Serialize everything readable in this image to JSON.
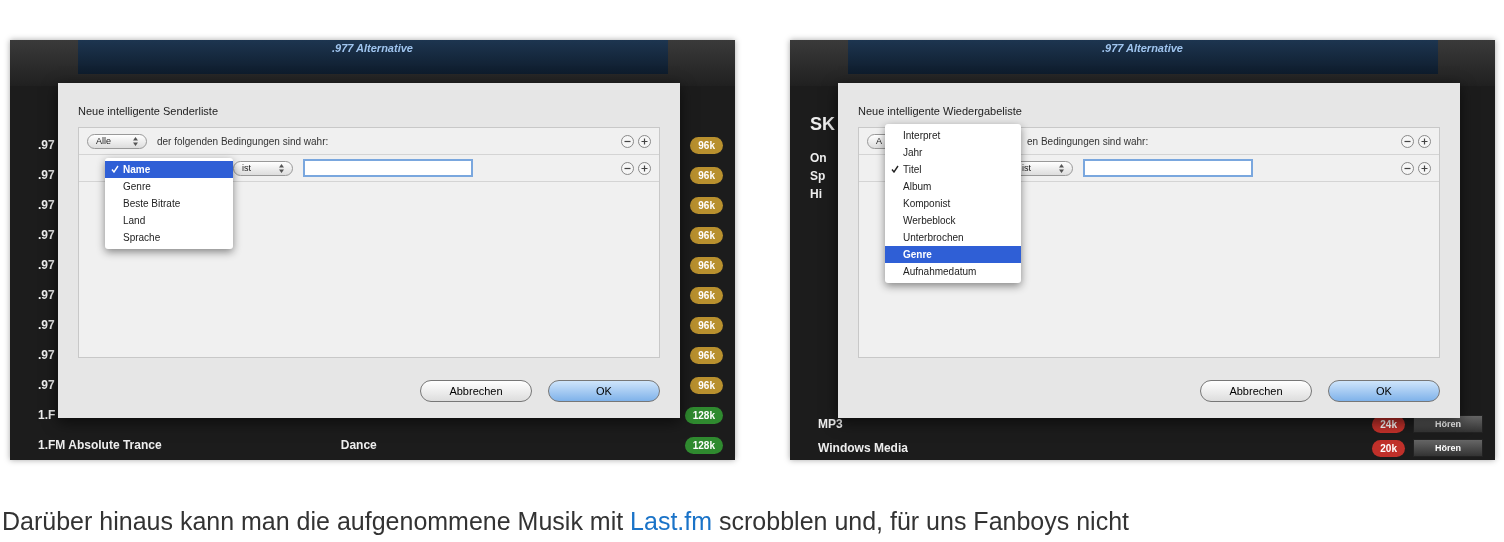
{
  "screenshots": [
    {
      "app_title": ".977 Alternative",
      "rows": [
        {
          "name": ".97",
          "badge": "96k",
          "color": "#b8902e"
        },
        {
          "name": ".97",
          "badge": "96k",
          "color": "#b8902e"
        },
        {
          "name": ".97",
          "badge": "96k",
          "color": "#b8902e"
        },
        {
          "name": ".97",
          "badge": "96k",
          "color": "#b8902e"
        },
        {
          "name": ".97",
          "badge": "96k",
          "color": "#b8902e"
        },
        {
          "name": ".97",
          "badge": "96k",
          "color": "#b8902e"
        },
        {
          "name": ".97",
          "badge": "96k",
          "color": "#b8902e"
        },
        {
          "name": ".97",
          "badge": "96k",
          "color": "#b8902e"
        },
        {
          "name": ".97",
          "badge": "96k",
          "color": "#b8902e"
        },
        {
          "name": "1.F",
          "badge": "128k",
          "color": "#2f8a2f"
        },
        {
          "name": "1.FM Absolute Trance",
          "genre": "Dance",
          "badge": "128k",
          "color": "#2f8a2f"
        }
      ],
      "dialog": {
        "title": "Neue intelligente Senderliste",
        "match_select": "Alle",
        "match_text": "der folgenden Bedingungen sind wahr:",
        "operator_select": "ist",
        "menu": [
          {
            "label": "Name",
            "checked": true,
            "selected": true
          },
          {
            "label": "Genre",
            "checked": false,
            "selected": false
          },
          {
            "label": "Beste Bitrate",
            "checked": false,
            "selected": false
          },
          {
            "label": "Land",
            "checked": false,
            "selected": false
          },
          {
            "label": "Sprache",
            "checked": false,
            "selected": false
          }
        ],
        "buttons": [
          "Abbrechen",
          "OK"
        ]
      }
    },
    {
      "app_title": ".977 Alternative",
      "side_texts": [
        "SK",
        "On",
        "Sp",
        "Hi"
      ],
      "rows": [
        {
          "name": "MP3",
          "badge": "24k",
          "color": "#c0302a",
          "action": "Hören"
        },
        {
          "name": "Windows Media",
          "badge": "20k",
          "color": "#c0302a",
          "action": "Hören"
        }
      ],
      "dialog": {
        "title": "Neue intelligente Wiedergabeliste",
        "match_select": "A",
        "match_text": "en Bedingungen sind wahr:",
        "operator_select": "ist",
        "menu": [
          {
            "label": "Interpret",
            "checked": false,
            "selected": false
          },
          {
            "label": "Jahr",
            "checked": false,
            "selected": false
          },
          {
            "label": "Titel",
            "checked": true,
            "selected": false
          },
          {
            "label": "Album",
            "checked": false,
            "selected": false
          },
          {
            "label": "Komponist",
            "checked": false,
            "selected": false
          },
          {
            "label": "Werbeblock",
            "checked": false,
            "selected": false
          },
          {
            "label": "Unterbrochen",
            "checked": false,
            "selected": false
          },
          {
            "label": "Genre",
            "checked": false,
            "selected": true
          },
          {
            "label": "Aufnahmedatum",
            "checked": false,
            "selected": false
          }
        ],
        "buttons": [
          "Abbrechen",
          "OK"
        ]
      }
    }
  ],
  "paragraph": {
    "before": "Darüber hinaus kann man die aufgenommene Musik mit",
    "link": "Last.fm",
    "after": "scrobblen und, für uns Fanboys nicht"
  }
}
